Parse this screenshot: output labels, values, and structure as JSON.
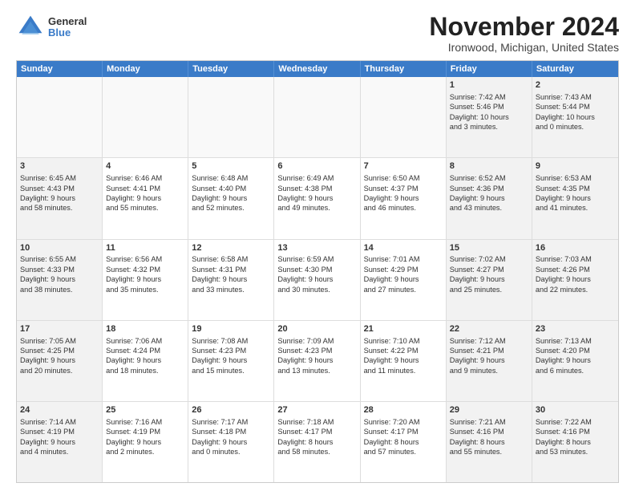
{
  "logo": {
    "general": "General",
    "blue": "Blue"
  },
  "header": {
    "month": "November 2024",
    "location": "Ironwood, Michigan, United States"
  },
  "weekdays": [
    "Sunday",
    "Monday",
    "Tuesday",
    "Wednesday",
    "Thursday",
    "Friday",
    "Saturday"
  ],
  "rows": [
    [
      {
        "day": "",
        "info": "",
        "empty": true
      },
      {
        "day": "",
        "info": "",
        "empty": true
      },
      {
        "day": "",
        "info": "",
        "empty": true
      },
      {
        "day": "",
        "info": "",
        "empty": true
      },
      {
        "day": "",
        "info": "",
        "empty": true
      },
      {
        "day": "1",
        "info": "Sunrise: 7:42 AM\nSunset: 5:46 PM\nDaylight: 10 hours\nand 3 minutes.",
        "empty": false
      },
      {
        "day": "2",
        "info": "Sunrise: 7:43 AM\nSunset: 5:44 PM\nDaylight: 10 hours\nand 0 minutes.",
        "empty": false
      }
    ],
    [
      {
        "day": "3",
        "info": "Sunrise: 6:45 AM\nSunset: 4:43 PM\nDaylight: 9 hours\nand 58 minutes.",
        "empty": false
      },
      {
        "day": "4",
        "info": "Sunrise: 6:46 AM\nSunset: 4:41 PM\nDaylight: 9 hours\nand 55 minutes.",
        "empty": false
      },
      {
        "day": "5",
        "info": "Sunrise: 6:48 AM\nSunset: 4:40 PM\nDaylight: 9 hours\nand 52 minutes.",
        "empty": false
      },
      {
        "day": "6",
        "info": "Sunrise: 6:49 AM\nSunset: 4:38 PM\nDaylight: 9 hours\nand 49 minutes.",
        "empty": false
      },
      {
        "day": "7",
        "info": "Sunrise: 6:50 AM\nSunset: 4:37 PM\nDaylight: 9 hours\nand 46 minutes.",
        "empty": false
      },
      {
        "day": "8",
        "info": "Sunrise: 6:52 AM\nSunset: 4:36 PM\nDaylight: 9 hours\nand 43 minutes.",
        "empty": false
      },
      {
        "day": "9",
        "info": "Sunrise: 6:53 AM\nSunset: 4:35 PM\nDaylight: 9 hours\nand 41 minutes.",
        "empty": false
      }
    ],
    [
      {
        "day": "10",
        "info": "Sunrise: 6:55 AM\nSunset: 4:33 PM\nDaylight: 9 hours\nand 38 minutes.",
        "empty": false
      },
      {
        "day": "11",
        "info": "Sunrise: 6:56 AM\nSunset: 4:32 PM\nDaylight: 9 hours\nand 35 minutes.",
        "empty": false
      },
      {
        "day": "12",
        "info": "Sunrise: 6:58 AM\nSunset: 4:31 PM\nDaylight: 9 hours\nand 33 minutes.",
        "empty": false
      },
      {
        "day": "13",
        "info": "Sunrise: 6:59 AM\nSunset: 4:30 PM\nDaylight: 9 hours\nand 30 minutes.",
        "empty": false
      },
      {
        "day": "14",
        "info": "Sunrise: 7:01 AM\nSunset: 4:29 PM\nDaylight: 9 hours\nand 27 minutes.",
        "empty": false
      },
      {
        "day": "15",
        "info": "Sunrise: 7:02 AM\nSunset: 4:27 PM\nDaylight: 9 hours\nand 25 minutes.",
        "empty": false
      },
      {
        "day": "16",
        "info": "Sunrise: 7:03 AM\nSunset: 4:26 PM\nDaylight: 9 hours\nand 22 minutes.",
        "empty": false
      }
    ],
    [
      {
        "day": "17",
        "info": "Sunrise: 7:05 AM\nSunset: 4:25 PM\nDaylight: 9 hours\nand 20 minutes.",
        "empty": false
      },
      {
        "day": "18",
        "info": "Sunrise: 7:06 AM\nSunset: 4:24 PM\nDaylight: 9 hours\nand 18 minutes.",
        "empty": false
      },
      {
        "day": "19",
        "info": "Sunrise: 7:08 AM\nSunset: 4:23 PM\nDaylight: 9 hours\nand 15 minutes.",
        "empty": false
      },
      {
        "day": "20",
        "info": "Sunrise: 7:09 AM\nSunset: 4:23 PM\nDaylight: 9 hours\nand 13 minutes.",
        "empty": false
      },
      {
        "day": "21",
        "info": "Sunrise: 7:10 AM\nSunset: 4:22 PM\nDaylight: 9 hours\nand 11 minutes.",
        "empty": false
      },
      {
        "day": "22",
        "info": "Sunrise: 7:12 AM\nSunset: 4:21 PM\nDaylight: 9 hours\nand 9 minutes.",
        "empty": false
      },
      {
        "day": "23",
        "info": "Sunrise: 7:13 AM\nSunset: 4:20 PM\nDaylight: 9 hours\nand 6 minutes.",
        "empty": false
      }
    ],
    [
      {
        "day": "24",
        "info": "Sunrise: 7:14 AM\nSunset: 4:19 PM\nDaylight: 9 hours\nand 4 minutes.",
        "empty": false
      },
      {
        "day": "25",
        "info": "Sunrise: 7:16 AM\nSunset: 4:19 PM\nDaylight: 9 hours\nand 2 minutes.",
        "empty": false
      },
      {
        "day": "26",
        "info": "Sunrise: 7:17 AM\nSunset: 4:18 PM\nDaylight: 9 hours\nand 0 minutes.",
        "empty": false
      },
      {
        "day": "27",
        "info": "Sunrise: 7:18 AM\nSunset: 4:17 PM\nDaylight: 8 hours\nand 58 minutes.",
        "empty": false
      },
      {
        "day": "28",
        "info": "Sunrise: 7:20 AM\nSunset: 4:17 PM\nDaylight: 8 hours\nand 57 minutes.",
        "empty": false
      },
      {
        "day": "29",
        "info": "Sunrise: 7:21 AM\nSunset: 4:16 PM\nDaylight: 8 hours\nand 55 minutes.",
        "empty": false
      },
      {
        "day": "30",
        "info": "Sunrise: 7:22 AM\nSunset: 4:16 PM\nDaylight: 8 hours\nand 53 minutes.",
        "empty": false
      }
    ]
  ]
}
